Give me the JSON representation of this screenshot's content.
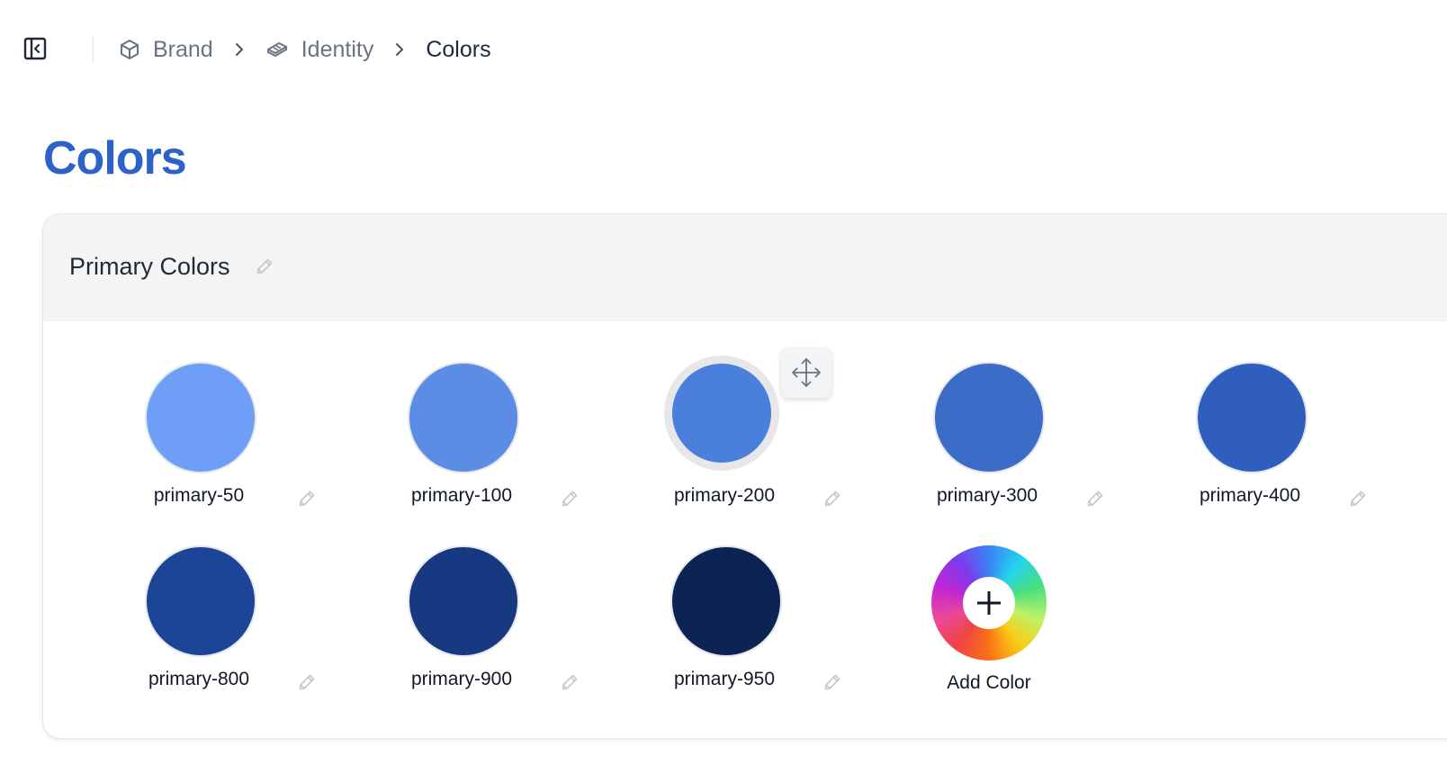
{
  "breadcrumb": {
    "items": [
      {
        "label": "Brand",
        "icon": "cube-icon"
      },
      {
        "label": "Identity",
        "icon": "layers-icon"
      },
      {
        "label": "Colors"
      }
    ]
  },
  "page": {
    "title": "Colors"
  },
  "palette": {
    "title": "Primary Colors",
    "swatches": [
      {
        "name": "primary-50",
        "color": "#6e9ef5"
      },
      {
        "name": "primary-100",
        "color": "#5b8de4"
      },
      {
        "name": "primary-200",
        "color": "#4a7fdb",
        "selected": true
      },
      {
        "name": "primary-300",
        "color": "#3a6cc8"
      },
      {
        "name": "primary-400",
        "color": "#2f5ebf"
      },
      {
        "name": "primary-800",
        "color": "#1c4598"
      },
      {
        "name": "primary-900",
        "color": "#173982"
      },
      {
        "name": "primary-950",
        "color": "#0c2454"
      }
    ],
    "add_label": "Add Color"
  },
  "colors": {
    "accent": "#2d62c8",
    "header_bg": "#f4f4f5"
  }
}
